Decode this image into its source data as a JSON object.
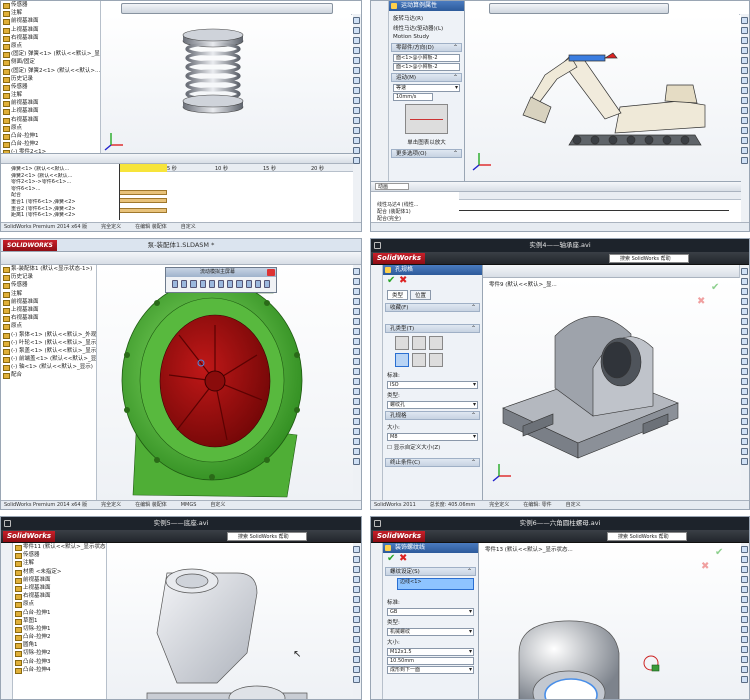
{
  "p1": {
    "tree": [
      "传感器",
      "注解",
      "前视基准面",
      "上视基准面",
      "右视基准面",
      "原点",
      "(固定) 弹簧<1> (默认<<默认>_显",
      "侧面/固定",
      "(固定) 弹簧2<1> (默认<<默认>...",
      "历史记录",
      "传感器",
      "注解",
      "前视基准面",
      "上视基准面",
      "右视基准面",
      "原点",
      "凸台-拉伸1",
      "凸台-拉伸2",
      "(-) 零件2<1>",
      "零件6<1> 中的配合"
    ],
    "ruler": [
      "0 秒",
      "5 秒",
      "10 秒",
      "15 秒",
      "20 秒"
    ],
    "tl_rows": [
      "弹簧<1> (默认<<默认...",
      "弹簧2<1> (默认<<默认...",
      "零件2<1>->零件6<1>...",
      "零件6<1>...",
      "配合",
      "重合1 (零件6<1>,弹簧<2>",
      "重合2 (零件6<1>,弹簧<2>",
      "距离1 (零件6<1>,弹簧<2>"
    ],
    "status": [
      "SolidWorks Premium 2014 x64 版",
      "完全定义",
      "在编辑 装配体",
      "自定义"
    ]
  },
  "p2": {
    "pm_title": "运动算例属性",
    "pm_rows": [
      "旋转马达(R)",
      "线性马达(驱动器)(L)",
      "Motion Study"
    ],
    "sec1": "零部件/方向(D)",
    "fields1": [
      "面<1>@小臂板-2",
      "面<1>@小臂板-2"
    ],
    "sec2": "运动(M)",
    "motion_type": "等速",
    "speed_label": "10mm/s",
    "graph_caption": "单击图表以放大",
    "sec3": "更多选项(O)",
    "tl_rows": [
      "线性马达4 (线性...",
      "配合 (装配体1)",
      "配合(完全)"
    ],
    "tl_select": "动画"
  },
  "p3": {
    "title": "泵-装配体1.SLDASM *",
    "dialog_title": "流动模拟主屏幕",
    "tree": [
      "泵-装配体1 (默认<显示状态-1>)",
      "历史记录",
      "传感器",
      "注解",
      "前视基准面",
      "上视基准面",
      "右视基准面",
      "原点",
      "(-) 泵体<1> (默认<<默认>_外观)",
      "(-) 叶轮<1> (默认<<默认>_显示)",
      "(-) 泵盖<1> (默认<<默认>_显示)",
      "(-) 前端盖<1> (默认<<默认>_显",
      "(-) 轴<1> (默认<<默认>_显示)",
      "配合"
    ],
    "status": [
      "SolidWorks Premium 2014 x64 版",
      "完全定义",
      "在编辑 装配体",
      "MMGS",
      "自定义"
    ]
  },
  "p4": {
    "title": "实例4——轴承座.avi",
    "search": "搜索 SolidWorks 帮助",
    "breadcrumb": "零件9 (默认<<默认>_显...",
    "pm_title": "孔规格",
    "tabs": [
      "类型",
      "位置"
    ],
    "sec_fav": "收藏(F)",
    "sec_type": "孔类型(T)",
    "std_label": "标准:",
    "std_value": "ISO",
    "type_label": "类型:",
    "type_value": "螺纹孔",
    "sec_spec": "孔规格",
    "size_label": "大小:",
    "size_value": "M8",
    "custom_label": "显示自定义大小(Z)",
    "end_cond": "终止条件(C)",
    "status": [
      "SolidWorks 2011",
      "总长度: 405.06mm",
      "完全定义",
      "在编辑: 零件",
      "自定义"
    ]
  },
  "p5": {
    "title": "实例5——底座.avi",
    "search": "搜索 SolidWorks 帮助",
    "tree": [
      "零件11 (默认<<默认>_显示状态",
      "传感器",
      "注解",
      "材质 <未指定>",
      "前视基准面",
      "上视基准面",
      "右视基准面",
      "原点",
      "凸台-拉伸1",
      "草图1",
      "切除-拉伸1",
      "凸台-拉伸2",
      "圆角1",
      "切除-拉伸2",
      "凸台-拉伸3",
      "凸台-拉伸4"
    ]
  },
  "p6": {
    "title": "实例6——六角圆柱螺母.avi",
    "search": "搜索 SolidWorks 帮助",
    "breadcrumb": "零件13 (默认<<默认>_显示状态...",
    "pm_title": "装饰螺纹线",
    "sec": "螺纹设定(S)",
    "edge_field": "边线<1>",
    "std_label": "标准:",
    "std_value": "GB",
    "type_label": "类型:",
    "type_value": "机械螺纹",
    "size_label": "大小:",
    "size_value": "M12x1.5",
    "depth_value": "10.50mm",
    "end_value": "成形到下一面"
  }
}
